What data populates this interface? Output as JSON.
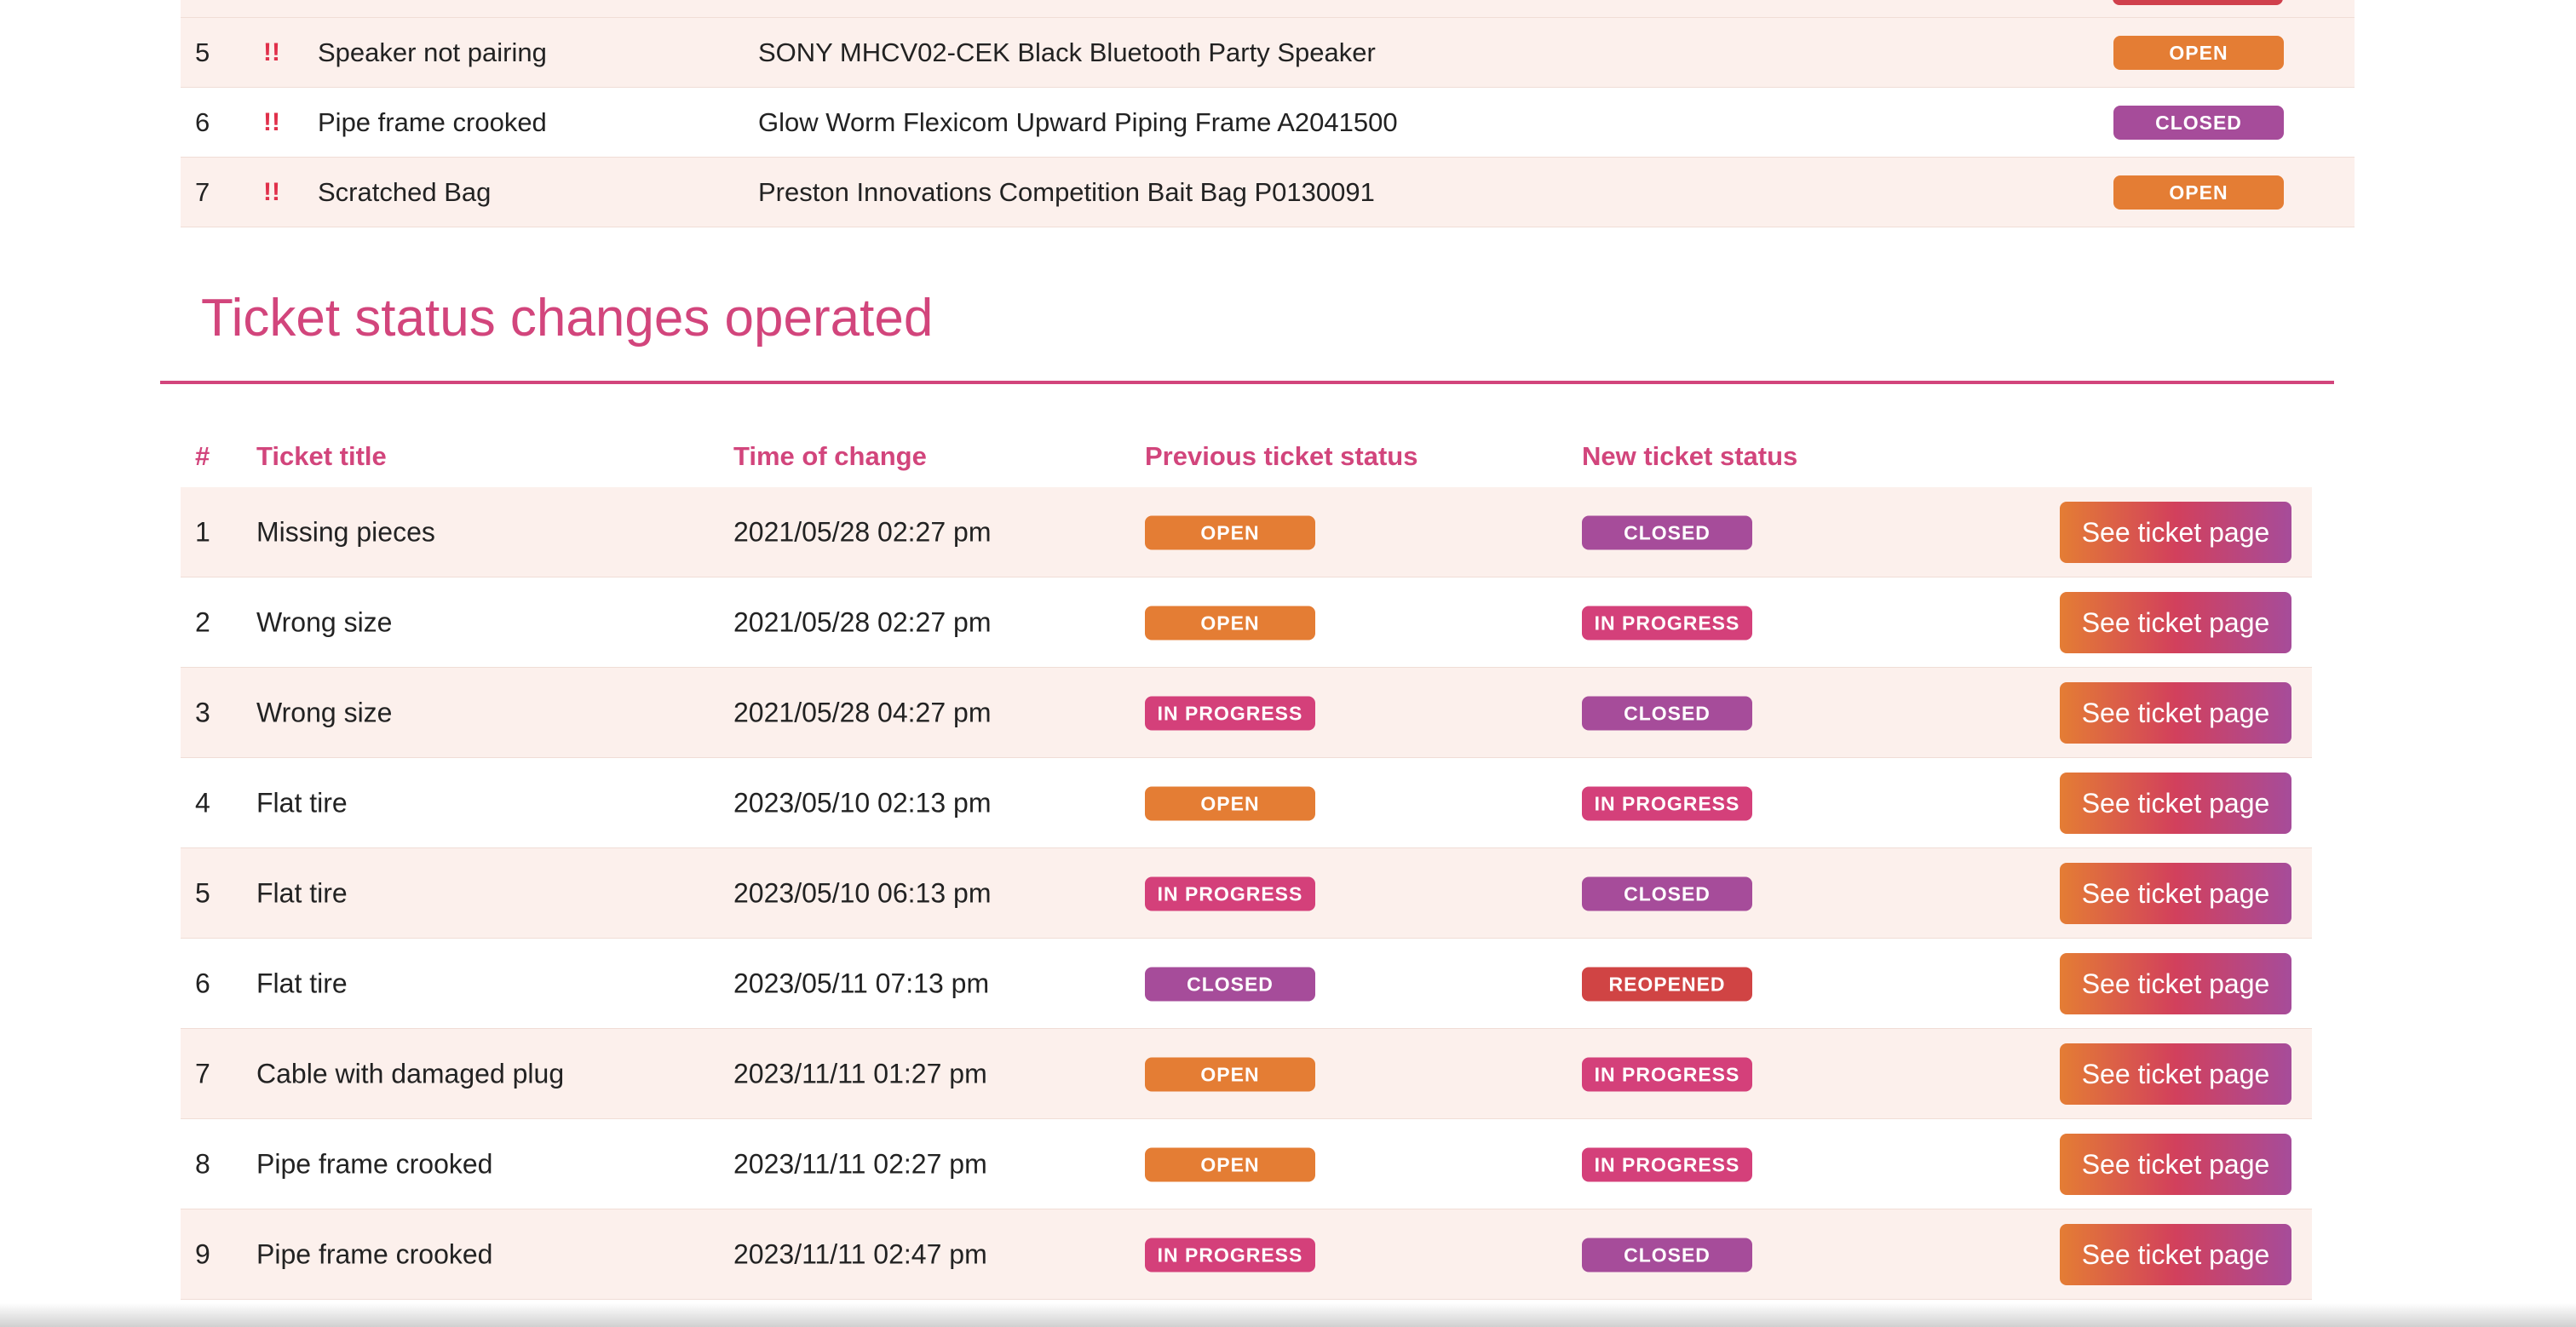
{
  "top_tickets": {
    "rows": [
      {
        "num": "5",
        "priority": "!!",
        "title": "Speaker not pairing",
        "product": "SONY MHCV02-CEK Black Bluetooth Party Speaker",
        "status": "OPEN"
      },
      {
        "num": "6",
        "priority": "!!",
        "title": "Pipe frame crooked",
        "product": "Glow Worm Flexicom Upward Piping Frame A2041500",
        "status": "CLOSED"
      },
      {
        "num": "7",
        "priority": "!!",
        "title": "Scratched Bag",
        "product": "Preston Innovations Competition Bait Bag P0130091",
        "status": "OPEN"
      }
    ]
  },
  "status_changes": {
    "title": "Ticket status changes operated",
    "headers": {
      "num": "#",
      "title": "Ticket title",
      "time": "Time of change",
      "previous": "Previous ticket status",
      "new": "New ticket status"
    },
    "button_label": "See ticket page",
    "rows": [
      {
        "num": "1",
        "title": "Missing pieces",
        "time": "2021/05/28 02:27 pm",
        "previous": "OPEN",
        "new": "CLOSED"
      },
      {
        "num": "2",
        "title": "Wrong size",
        "time": "2021/05/28 02:27 pm",
        "previous": "OPEN",
        "new": "IN PROGRESS"
      },
      {
        "num": "3",
        "title": "Wrong size",
        "time": "2021/05/28 04:27 pm",
        "previous": "IN PROGRESS",
        "new": "CLOSED"
      },
      {
        "num": "4",
        "title": "Flat tire",
        "time": "2023/05/10 02:13 pm",
        "previous": "OPEN",
        "new": "IN PROGRESS"
      },
      {
        "num": "5",
        "title": "Flat tire",
        "time": "2023/05/10 06:13 pm",
        "previous": "IN PROGRESS",
        "new": "CLOSED"
      },
      {
        "num": "6",
        "title": "Flat tire",
        "time": "2023/05/11 07:13 pm",
        "previous": "CLOSED",
        "new": "REOPENED"
      },
      {
        "num": "7",
        "title": "Cable with damaged plug",
        "time": "2023/11/11 01:27 pm",
        "previous": "OPEN",
        "new": "IN PROGRESS"
      },
      {
        "num": "8",
        "title": "Pipe frame crooked",
        "time": "2023/11/11 02:27 pm",
        "previous": "OPEN",
        "new": "IN PROGRESS"
      },
      {
        "num": "9",
        "title": "Pipe frame crooked",
        "time": "2023/11/11 02:47 pm",
        "previous": "IN PROGRESS",
        "new": "CLOSED"
      }
    ]
  },
  "colors": {
    "accent": "#d2457c",
    "status_open": "#e47d34",
    "status_closed": "#a64c9a",
    "status_in_progress": "#d4407a",
    "status_reopened": "#d04444",
    "row_tint": "#fcf0ec",
    "priority": "#e0304a"
  }
}
